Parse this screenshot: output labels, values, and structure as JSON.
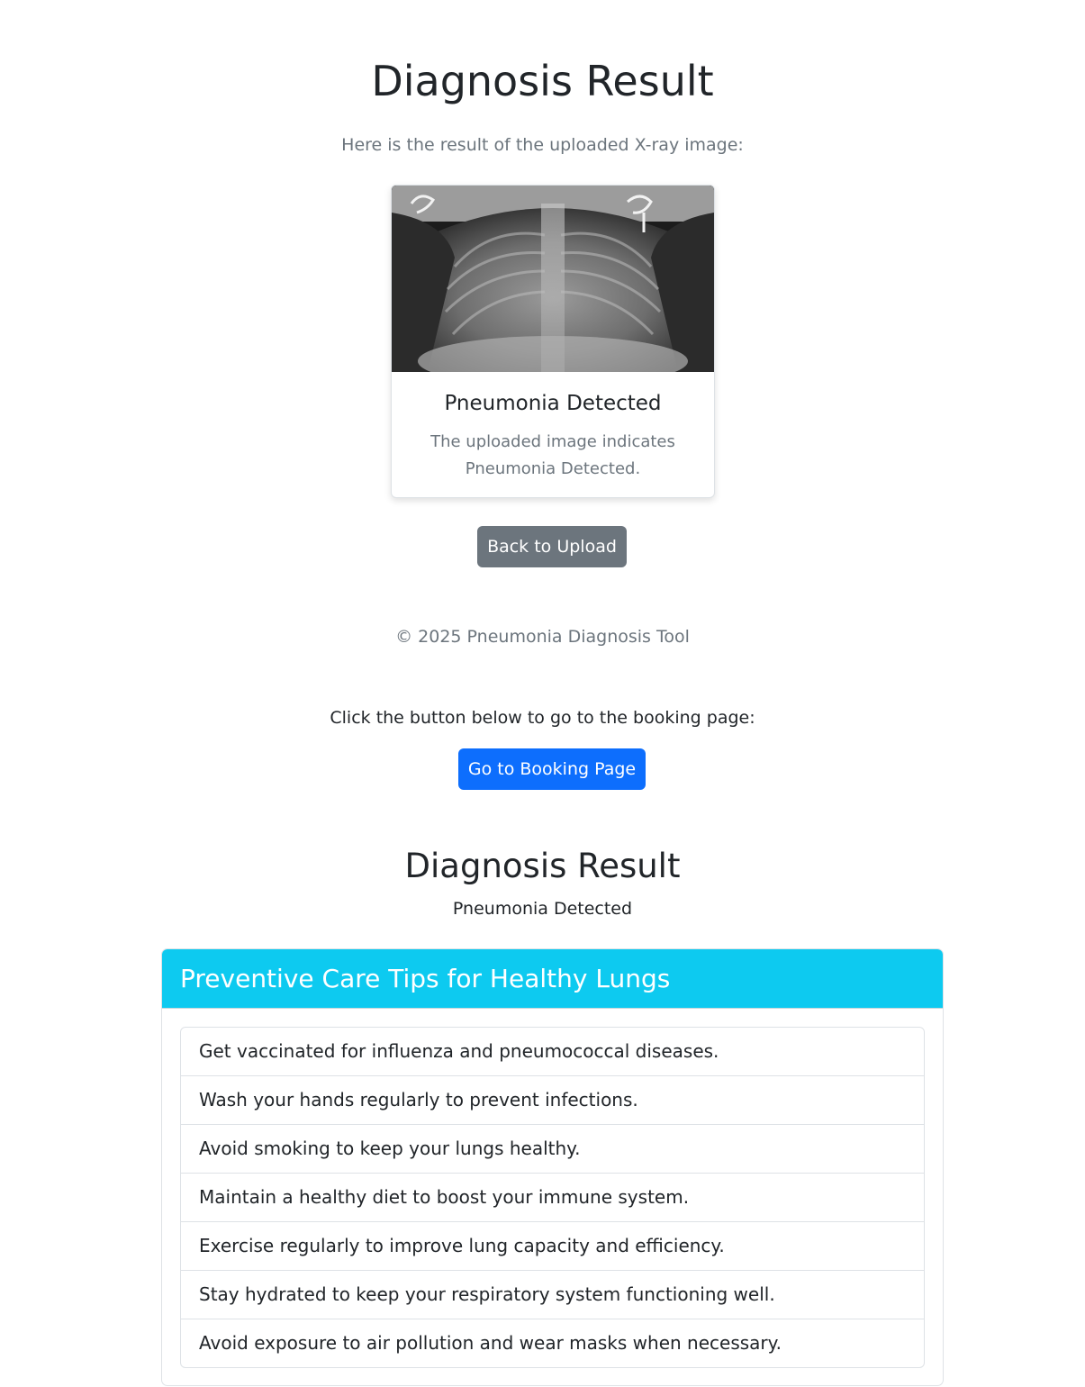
{
  "header": {
    "title": "Diagnosis Result",
    "subtitle": "Here is the result of the uploaded X-ray image:"
  },
  "result_card": {
    "image_alt": "chest-xray-image",
    "title": "Pneumonia Detected",
    "text": "The uploaded image indicates Pneumonia Detected."
  },
  "actions": {
    "back_label": "Back to Upload"
  },
  "footer": {
    "text": "© 2025 Pneumonia Diagnosis Tool"
  },
  "booking": {
    "prompt": "Click the button below to go to the booking page:",
    "button_label": "Go to Booking Page"
  },
  "summary": {
    "title": "Diagnosis Result",
    "status": "Pneumonia Detected"
  },
  "tips": {
    "heading": "Preventive Care Tips for Healthy Lungs",
    "items": [
      "Get vaccinated for influenza and pneumococcal diseases.",
      "Wash your hands regularly to prevent infections.",
      "Avoid smoking to keep your lungs healthy.",
      "Maintain a healthy diet to boost your immune system.",
      "Exercise regularly to improve lung capacity and efficiency.",
      "Stay hydrated to keep your respiratory system functioning well.",
      "Avoid exposure to air pollution and wear masks when necessary."
    ]
  },
  "colors": {
    "primary": "#0d6efd",
    "secondary": "#6c757d",
    "info": "#0dcaf0"
  }
}
